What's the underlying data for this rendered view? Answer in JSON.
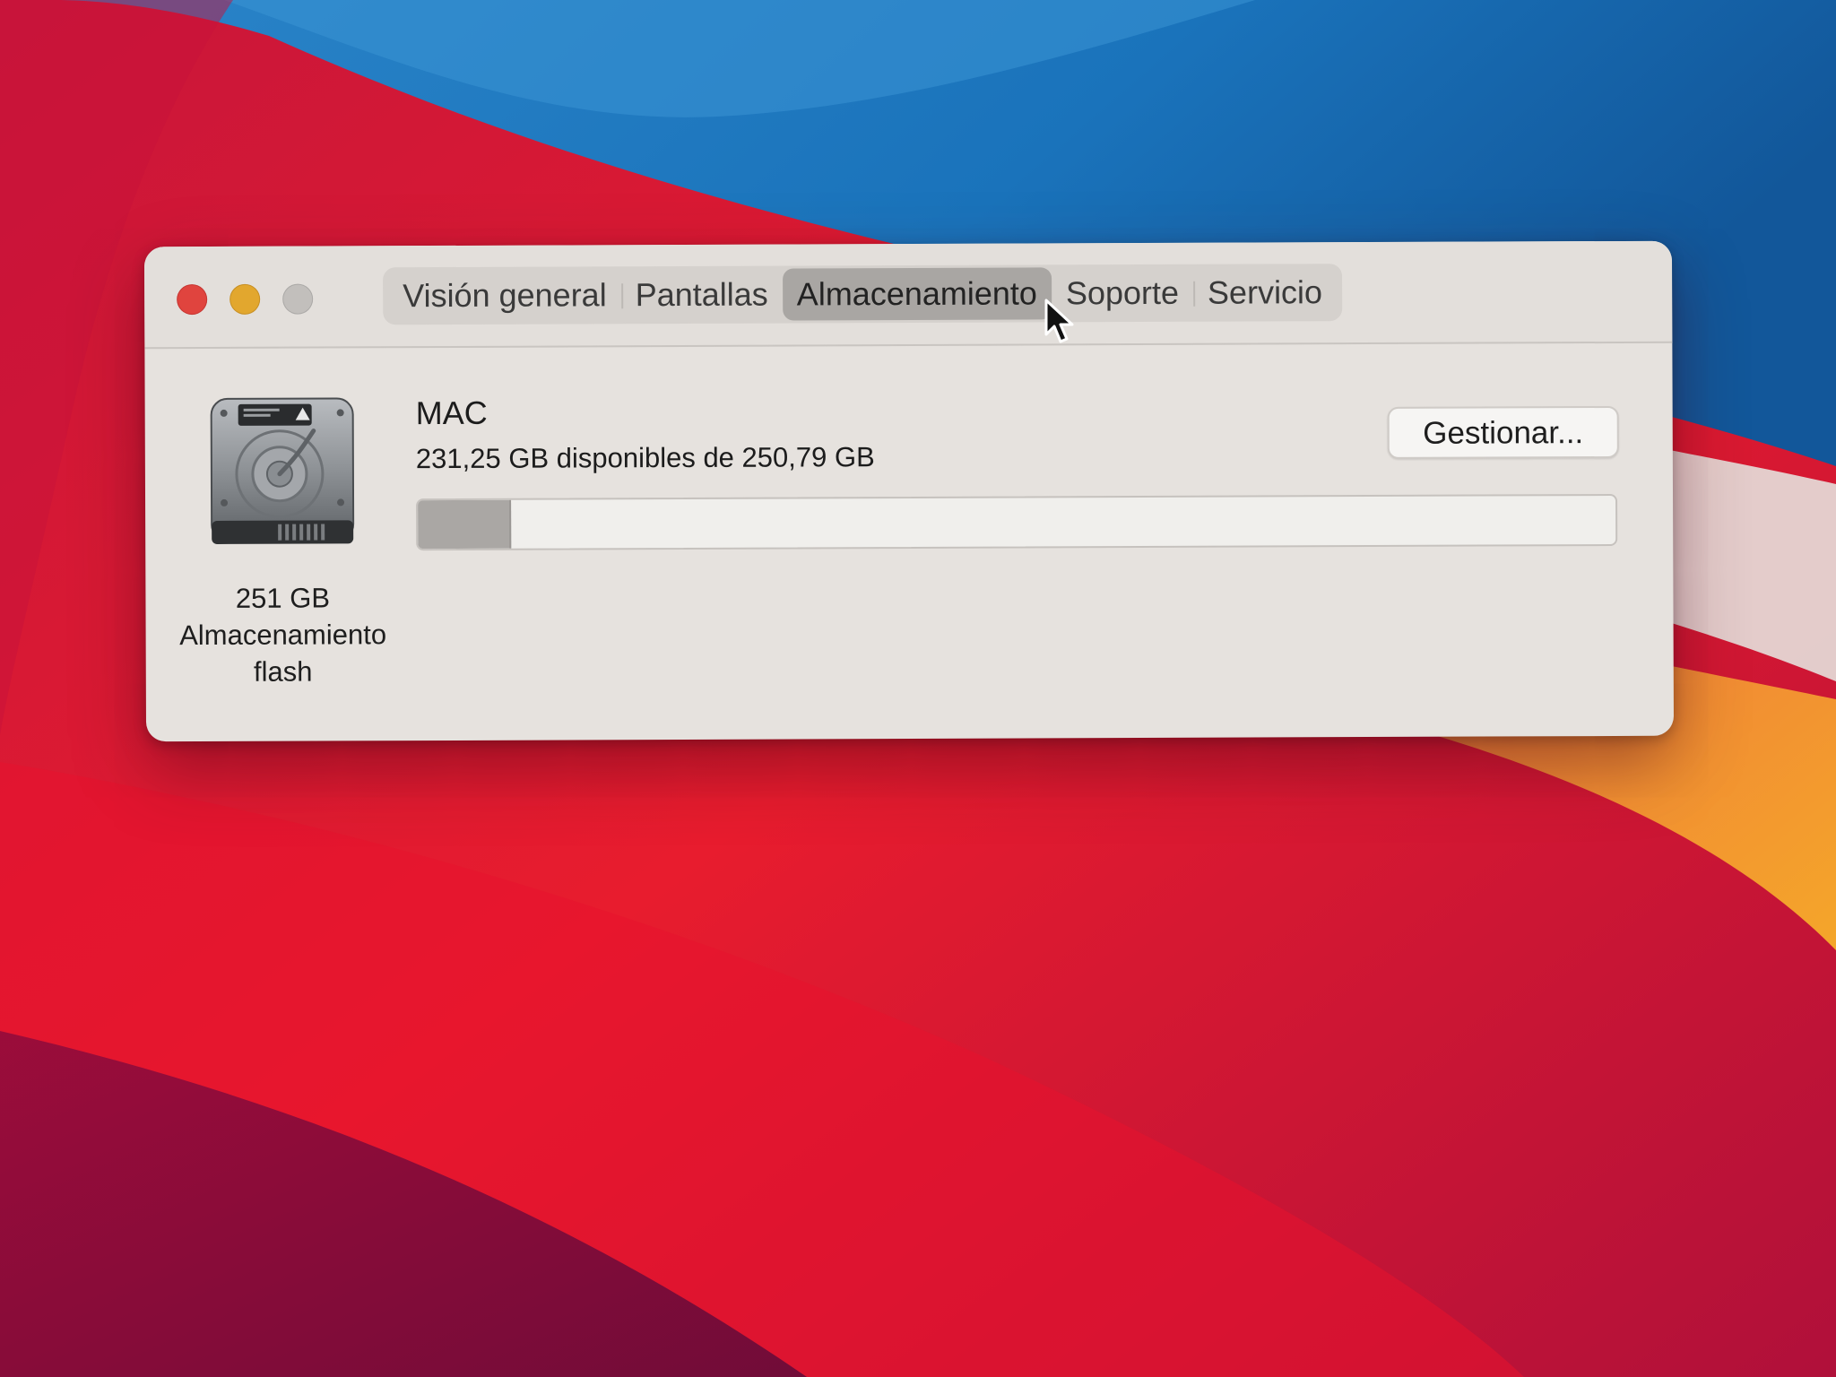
{
  "colors": {
    "wallpaper_red": "#d8102a",
    "wallpaper_blue": "#1d78c1",
    "wallpaper_orange": "#f2a227",
    "window_bg": "#e6e2de",
    "active_tab": "#a9a6a3"
  },
  "window": {
    "traffic_lights": [
      "close",
      "minimize",
      "zoom"
    ],
    "tabs": [
      {
        "label": "Visión general",
        "active": false
      },
      {
        "label": "Pantallas",
        "active": false
      },
      {
        "label": "Almacenamiento",
        "active": true
      },
      {
        "label": "Soporte",
        "active": false
      },
      {
        "label": "Servicio",
        "active": false
      }
    ]
  },
  "storage": {
    "disk_icon": "hard-drive-icon",
    "disk_size": "251 GB",
    "disk_type_line1": "Almacenamiento",
    "disk_type_line2": "flash",
    "volume_name": "MAC",
    "volume_info": "231,25 GB disponibles de 250,79 GB",
    "manage_button": "Gestionar...",
    "used_fraction": 0.078
  }
}
